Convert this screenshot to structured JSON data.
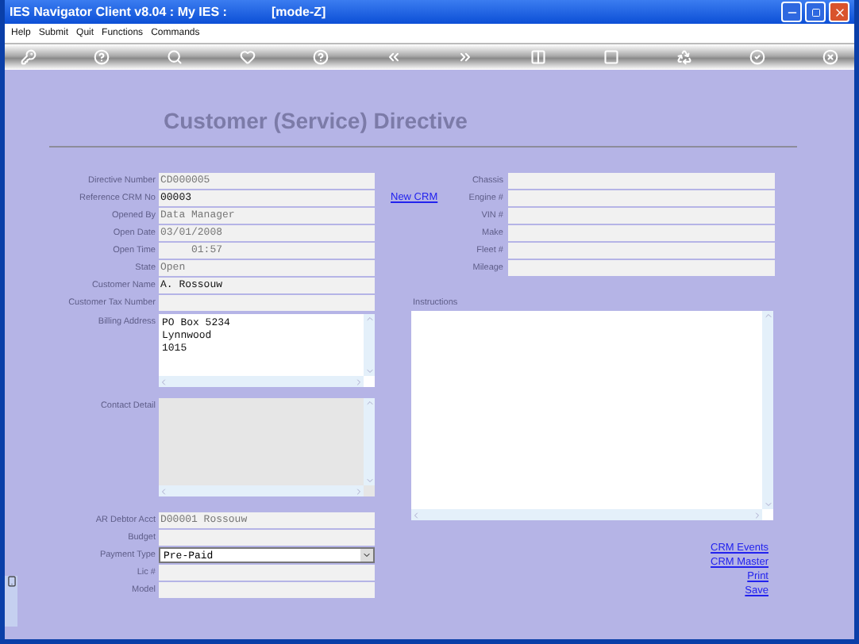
{
  "window": {
    "title": "IES Navigator Client v8.04 : My IES :",
    "mode": "[mode-Z]"
  },
  "menu": [
    "Help",
    "Submit",
    "Quit",
    "Functions",
    "Commands"
  ],
  "heading": "Customer (Service) Directive",
  "left_fields": [
    {
      "label": "Directive Number",
      "kind": "text",
      "value": "CD000005",
      "disabled": true
    },
    {
      "label": "Reference CRM No",
      "kind": "text",
      "value": "00003",
      "disabled": false
    },
    {
      "label": "Opened By",
      "kind": "text",
      "value": "Data Manager",
      "disabled": true
    },
    {
      "label": "Open Date",
      "kind": "text",
      "value": "03/01/2008",
      "disabled": true
    },
    {
      "label": "Open Time",
      "kind": "text",
      "value": "     01:57",
      "disabled": true
    },
    {
      "label": "State",
      "kind": "text",
      "value": "Open",
      "disabled": true
    },
    {
      "label": "Customer Name",
      "kind": "text",
      "value": "A. Rossouw",
      "disabled": false
    },
    {
      "label": "Customer Tax Number",
      "kind": "text"
    },
    {
      "label": "Billing Address",
      "kind": "textarea",
      "lines": [
        "PO Box 5234",
        "Lynnwood",
        "1015"
      ],
      "disabled": false
    },
    {
      "label": "Contact Detail",
      "kind": "textarea",
      "disabled": true
    },
    {
      "label": "AR Debtor Acct",
      "kind": "text",
      "value": "D00001 Rossouw",
      "disabled": true
    },
    {
      "label": "Budget",
      "kind": "text"
    },
    {
      "label": "Payment Type",
      "kind": "select",
      "value": "Pre-Paid"
    },
    {
      "label": "Lic #",
      "kind": "text"
    },
    {
      "label": "Model",
      "kind": "text"
    }
  ],
  "new_crm_link": "New CRM",
  "right_fields": [
    {
      "label": "Chassis"
    },
    {
      "label": "Engine #"
    },
    {
      "label": "VIN #"
    },
    {
      "label": "Make"
    },
    {
      "label": "Fleet #"
    },
    {
      "label": "Mileage"
    }
  ],
  "instructions": {
    "label": "Instructions"
  },
  "links": [
    "CRM Events",
    "CRM Master",
    "Print",
    "Save"
  ]
}
